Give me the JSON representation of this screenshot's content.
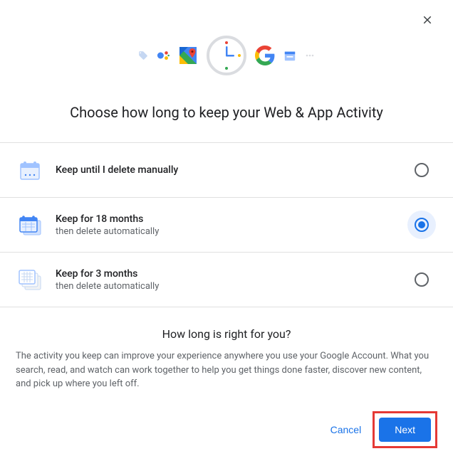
{
  "title": "Choose how long to keep your Web & App Activity",
  "options": [
    {
      "title": "Keep until I delete manually",
      "sub": "",
      "selected": false
    },
    {
      "title": "Keep for 18 months",
      "sub": "then delete automatically",
      "selected": true
    },
    {
      "title": "Keep for 3 months",
      "sub": "then delete automatically",
      "selected": false
    }
  ],
  "info": {
    "title": "How long is right for you?",
    "body": "The activity you keep can improve your experience anywhere you use your Google Account. What you search, read, and watch can work together to help you get things done faster, discover new content, and pick up where you left off."
  },
  "buttons": {
    "cancel": "Cancel",
    "next": "Next"
  }
}
